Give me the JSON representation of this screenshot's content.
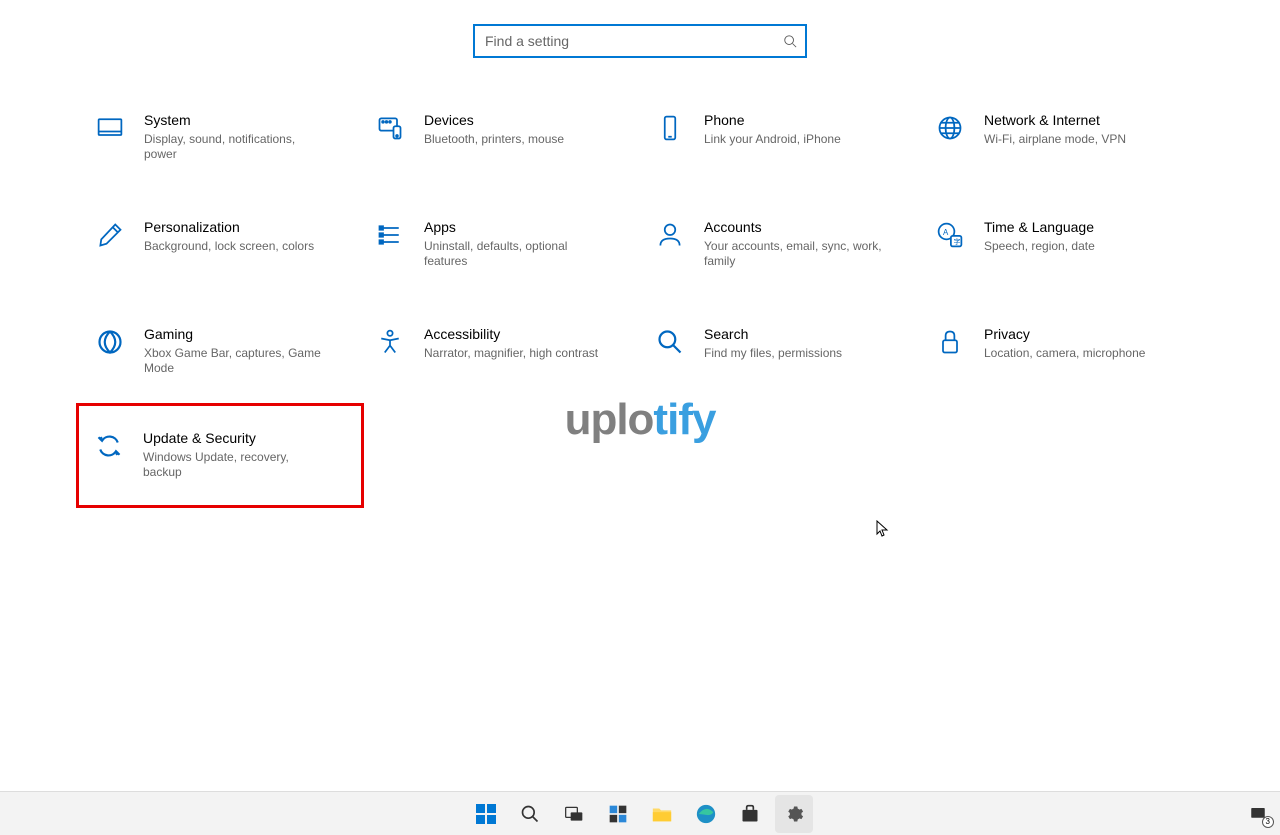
{
  "search": {
    "placeholder": "Find a setting"
  },
  "tiles": [
    {
      "id": "system",
      "title": "System",
      "desc": "Display, sound, notifications, power"
    },
    {
      "id": "devices",
      "title": "Devices",
      "desc": "Bluetooth, printers, mouse"
    },
    {
      "id": "phone",
      "title": "Phone",
      "desc": "Link your Android, iPhone"
    },
    {
      "id": "network",
      "title": "Network & Internet",
      "desc": "Wi-Fi, airplane mode, VPN"
    },
    {
      "id": "personalization",
      "title": "Personalization",
      "desc": "Background, lock screen, colors"
    },
    {
      "id": "apps",
      "title": "Apps",
      "desc": "Uninstall, defaults, optional features"
    },
    {
      "id": "accounts",
      "title": "Accounts",
      "desc": "Your accounts, email, sync, work, family"
    },
    {
      "id": "time-language",
      "title": "Time & Language",
      "desc": "Speech, region, date"
    },
    {
      "id": "gaming",
      "title": "Gaming",
      "desc": "Xbox Game Bar, captures, Game Mode"
    },
    {
      "id": "accessibility",
      "title": "Accessibility",
      "desc": "Narrator, magnifier, high contrast"
    },
    {
      "id": "search",
      "title": "Search",
      "desc": "Find my files, permissions"
    },
    {
      "id": "privacy",
      "title": "Privacy",
      "desc": "Location, camera, microphone"
    },
    {
      "id": "update-security",
      "title": "Update & Security",
      "desc": "Windows Update, recovery, backup",
      "highlighted": true
    }
  ],
  "watermark": {
    "part1": "uplo",
    "part2": "tify"
  },
  "taskbar": {
    "items": [
      "start",
      "search",
      "taskview",
      "widgets",
      "explorer",
      "edge",
      "store",
      "settings"
    ],
    "tray_badge": "3"
  }
}
